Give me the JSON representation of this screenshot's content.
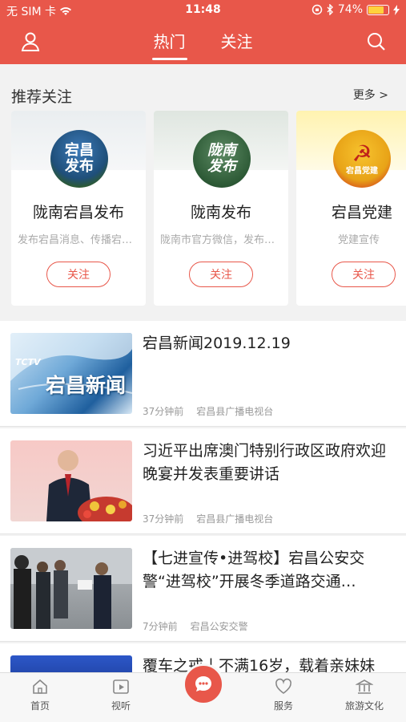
{
  "status": {
    "carrier": "无 SIM 卡",
    "time": "11:48",
    "battery": "74%",
    "battery_level": 0.74
  },
  "header": {
    "tabs": [
      "热门",
      "关注"
    ],
    "active_tab": 0
  },
  "recommend": {
    "title": "推荐关注",
    "more": "更多 >",
    "cards": [
      {
        "name": "陇南宕昌发布",
        "desc": "发布宕昌消息、传播宕昌声音",
        "follow": "关注",
        "logo": "宕昌发布"
      },
      {
        "name": "陇南发布",
        "desc": "陇南市官方微信，发布权威信息",
        "follow": "关注",
        "logo": "陇南发布"
      },
      {
        "name": "宕昌党建",
        "desc": "党建宣传",
        "follow": "关注",
        "logo": "宕昌党建"
      }
    ]
  },
  "news": [
    {
      "title": "宕昌新闻2019.12.19",
      "time": "37分钟前",
      "source": "宕昌县广播电视台",
      "thumb_text": "宕昌新闻",
      "thumb_tag": "TCTV"
    },
    {
      "title": "习近平出席澳门特别行政区政府欢迎晚宴并发表重要讲话",
      "time": "37分钟前",
      "source": "宕昌县广播电视台"
    },
    {
      "title": "【七进宣传•进驾校】宕昌公安交警“进驾校”开展冬季道路交通…",
      "time": "7分钟前",
      "source": "宕昌公安交警"
    },
    {
      "title": "覆车之戒丨不满16岁，载着亲妹妹"
    }
  ],
  "tabbar": [
    {
      "label": "首页",
      "icon": "home-icon"
    },
    {
      "label": "视听",
      "icon": "video-icon"
    },
    {
      "label": "",
      "icon": "chat-bubble-icon"
    },
    {
      "label": "服务",
      "icon": "heart-icon"
    },
    {
      "label": "旅游文化",
      "icon": "culture-icon"
    }
  ],
  "colors": {
    "brand": "#e8574a"
  }
}
